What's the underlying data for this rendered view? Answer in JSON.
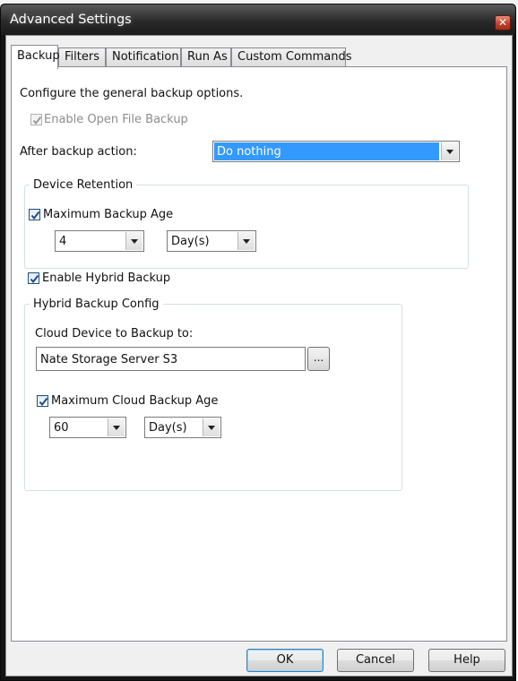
{
  "window": {
    "title": "Advanced Settings",
    "close_symbol": "✕"
  },
  "tabs": [
    {
      "label": "Backup",
      "active": true
    },
    {
      "label": "Filters"
    },
    {
      "label": "Notification"
    },
    {
      "label": "Run As"
    },
    {
      "label": "Custom Commands"
    }
  ],
  "backup": {
    "intro": "Configure the general backup options.",
    "open_file_backup": {
      "label": "Enable Open File Backup",
      "checked": true,
      "enabled": false
    },
    "after_action": {
      "label": "After backup action:",
      "value": "Do nothing"
    },
    "device_retention": {
      "title": "Device Retention",
      "max_age": {
        "label": "Maximum Backup Age",
        "checked": true
      },
      "age_value": "4",
      "age_unit": "Day(s)"
    },
    "hybrid": {
      "label": "Enable Hybrid Backup",
      "checked": true
    },
    "hybrid_config": {
      "title": "Hybrid Backup Config",
      "cloud_device_label": "Cloud Device to Backup to:",
      "cloud_device_value": "Nate Storage Server S3",
      "browse_label": "...",
      "max_cloud_age": {
        "label": "Maximum Cloud Backup Age",
        "checked": true
      },
      "cloud_age_value": "60",
      "cloud_age_unit": "Day(s)"
    }
  },
  "buttons": {
    "ok": "OK",
    "cancel": "Cancel",
    "help": "Help"
  },
  "colors": {
    "selection": "#3399ff",
    "title_bar": "#2a2a2a",
    "close_button": "#c4402a"
  }
}
